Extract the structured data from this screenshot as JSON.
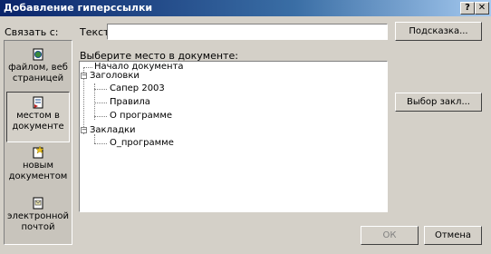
{
  "window": {
    "title": "Добавление гиперссылки",
    "help_glyph": "?",
    "close_glyph": "✕"
  },
  "link_to": {
    "label": "Связать с:",
    "items": [
      {
        "label_line1": "файлом, веб",
        "label_line2": "страницей",
        "icon": "web-page-icon",
        "selected": false
      },
      {
        "label_line1": "местом в",
        "label_line2": "документе",
        "icon": "document-place-icon",
        "selected": true
      },
      {
        "label_line1": "новым",
        "label_line2": "документом",
        "icon": "new-document-icon",
        "selected": false
      },
      {
        "label_line1": "электронной",
        "label_line2": "почтой",
        "icon": "email-icon",
        "selected": false
      }
    ]
  },
  "text_field": {
    "label": "Текст:",
    "value": ""
  },
  "buttons": {
    "hint": "Подсказка...",
    "bookmark": "Выбор закл...",
    "ok": "ОК",
    "cancel": "Отмена"
  },
  "tree": {
    "caption": "Выберите место в документе:",
    "nodes": [
      {
        "text": "Начало документа"
      },
      {
        "text": "Заголовки",
        "expander": "−"
      },
      {
        "text": "Сапер 2003"
      },
      {
        "text": "Правила"
      },
      {
        "text": "О программе"
      },
      {
        "text": "Закладки",
        "expander": "−"
      },
      {
        "text": "О_программе"
      }
    ]
  }
}
